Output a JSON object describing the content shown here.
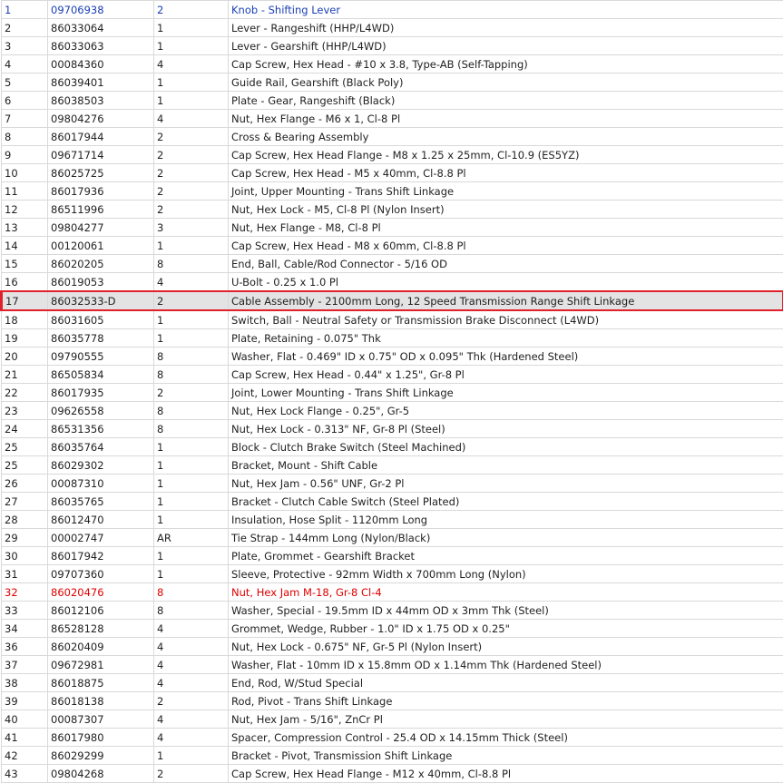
{
  "rows": [
    {
      "n": "1",
      "part": "09706938",
      "qty": "2",
      "desc": "Knob - Shifting Lever",
      "style": "blue"
    },
    {
      "n": "2",
      "part": "86033064",
      "qty": "1",
      "desc": "Lever - Rangeshift (HHP/L4WD)"
    },
    {
      "n": "3",
      "part": "86033063",
      "qty": "1",
      "desc": "Lever - Gearshift (HHP/L4WD)"
    },
    {
      "n": "4",
      "part": "00084360",
      "qty": "4",
      "desc": "Cap Screw, Hex Head - #10 x 3.8, Type-AB (Self-Tapping)"
    },
    {
      "n": "5",
      "part": "86039401",
      "qty": "1",
      "desc": "Guide Rail, Gearshift (Black Poly)"
    },
    {
      "n": "6",
      "part": "86038503",
      "qty": "1",
      "desc": "Plate - Gear, Rangeshift (Black)"
    },
    {
      "n": "7",
      "part": "09804276",
      "qty": "4",
      "desc": "Nut, Hex Flange - M6 x 1, Cl-8 Pl"
    },
    {
      "n": "8",
      "part": "86017944",
      "qty": "2",
      "desc": "Cross & Bearing Assembly"
    },
    {
      "n": "9",
      "part": "09671714",
      "qty": "2",
      "desc": "Cap Screw, Hex Head Flange - M8 x 1.25 x 25mm, Cl-10.9 (ES5YZ)"
    },
    {
      "n": "10",
      "part": "86025725",
      "qty": "2",
      "desc": "Cap Screw, Hex Head - M5 x 40mm, Cl-8.8 Pl"
    },
    {
      "n": "11",
      "part": "86017936",
      "qty": "2",
      "desc": "Joint, Upper Mounting - Trans Shift Linkage"
    },
    {
      "n": "12",
      "part": "86511996",
      "qty": "2",
      "desc": "Nut, Hex Lock - M5, Cl-8 Pl (Nylon Insert)"
    },
    {
      "n": "13",
      "part": "09804277",
      "qty": "3",
      "desc": "Nut, Hex Flange - M8, Cl-8 Pl"
    },
    {
      "n": "14",
      "part": "00120061",
      "qty": "1",
      "desc": "Cap Screw, Hex Head - M8 x 60mm, Cl-8.8 Pl"
    },
    {
      "n": "15",
      "part": "86020205",
      "qty": "8",
      "desc": "End, Ball, Cable/Rod Connector - 5/16 OD"
    },
    {
      "n": "16",
      "part": "86019053",
      "qty": "4",
      "desc": "U-Bolt - 0.25 x 1.0 Pl"
    },
    {
      "n": "17",
      "part": "86032533-D",
      "qty": "2",
      "desc": "Cable Assembly - 2100mm Long, 12 Speed Transmission Range Shift Linkage",
      "style": "sel"
    },
    {
      "n": "18",
      "part": "86031605",
      "qty": "1",
      "desc": "Switch, Ball - Neutral Safety or Transmission Brake Disconnect (L4WD)"
    },
    {
      "n": "19",
      "part": "86035778",
      "qty": "1",
      "desc": "Plate, Retaining - 0.075\" Thk"
    },
    {
      "n": "20",
      "part": "09790555",
      "qty": "8",
      "desc": "Washer, Flat - 0.469\" ID x 0.75\" OD x 0.095\" Thk (Hardened Steel)"
    },
    {
      "n": "21",
      "part": "86505834",
      "qty": "8",
      "desc": "Cap Screw, Hex Head - 0.44\" x 1.25\", Gr-8 Pl"
    },
    {
      "n": "22",
      "part": "86017935",
      "qty": "2",
      "desc": "Joint, Lower Mounting - Trans Shift Linkage"
    },
    {
      "n": "23",
      "part": "09626558",
      "qty": "8",
      "desc": "Nut, Hex Lock Flange - 0.25\", Gr-5"
    },
    {
      "n": "24",
      "part": "86531356",
      "qty": "8",
      "desc": "Nut, Hex Lock - 0.313\" NF, Gr-8 Pl (Steel)"
    },
    {
      "n": "25",
      "part": "86035764",
      "qty": "1",
      "desc": "Block - Clutch Brake Switch (Steel Machined)"
    },
    {
      "n": "25",
      "part": "86029302",
      "qty": "1",
      "desc": "Bracket, Mount - Shift Cable"
    },
    {
      "n": "26",
      "part": "00087310",
      "qty": "1",
      "desc": "Nut, Hex Jam - 0.56\" UNF, Gr-2 Pl"
    },
    {
      "n": "27",
      "part": "86035765",
      "qty": "1",
      "desc": "Bracket - Clutch Cable Switch (Steel Plated)"
    },
    {
      "n": "28",
      "part": "86012470",
      "qty": "1",
      "desc": "Insulation, Hose Split - 1120mm Long"
    },
    {
      "n": "29",
      "part": "00002747",
      "qty": "AR",
      "desc": "Tie Strap - 144mm Long (Nylon/Black)"
    },
    {
      "n": "30",
      "part": "86017942",
      "qty": "1",
      "desc": "Plate, Grommet - Gearshift Bracket"
    },
    {
      "n": "31",
      "part": "09707360",
      "qty": "1",
      "desc": "Sleeve, Protective - 92mm Width x 700mm Long (Nylon)"
    },
    {
      "n": "32",
      "part": "86020476",
      "qty": "8",
      "desc": "Nut, Hex Jam M-18, Gr-8 Cl-4",
      "style": "red"
    },
    {
      "n": "33",
      "part": "86012106",
      "qty": "8",
      "desc": "Washer, Special - 19.5mm ID x 44mm OD x 3mm Thk (Steel)"
    },
    {
      "n": "34",
      "part": "86528128",
      "qty": "4",
      "desc": "Grommet, Wedge, Rubber - 1.0\" ID x 1.75 OD x 0.25\""
    },
    {
      "n": "36",
      "part": "86020409",
      "qty": "4",
      "desc": "Nut, Hex Lock - 0.675\" NF, Gr-5 Pl (Nylon Insert)"
    },
    {
      "n": "37",
      "part": "09672981",
      "qty": "4",
      "desc": "Washer, Flat - 10mm ID x 15.8mm OD x 1.14mm Thk (Hardened Steel)"
    },
    {
      "n": "38",
      "part": "86018875",
      "qty": "4",
      "desc": "End, Rod, W/Stud Special"
    },
    {
      "n": "39",
      "part": "86018138",
      "qty": "2",
      "desc": "Rod, Pivot - Trans Shift Linkage"
    },
    {
      "n": "40",
      "part": "00087307",
      "qty": "4",
      "desc": "Nut, Hex Jam - 5/16\", ZnCr Pl"
    },
    {
      "n": "41",
      "part": "86017980",
      "qty": "4",
      "desc": "Spacer, Compression Control - 25.4 OD x 14.15mm Thick (Steel)"
    },
    {
      "n": "42",
      "part": "86029299",
      "qty": "1",
      "desc": "Bracket - Pivot, Transmission Shift Linkage"
    },
    {
      "n": "43",
      "part": "09804268",
      "qty": "2",
      "desc": "Cap Screw, Hex Head Flange - M12 x 40mm, Cl-8.8 Pl"
    }
  ]
}
